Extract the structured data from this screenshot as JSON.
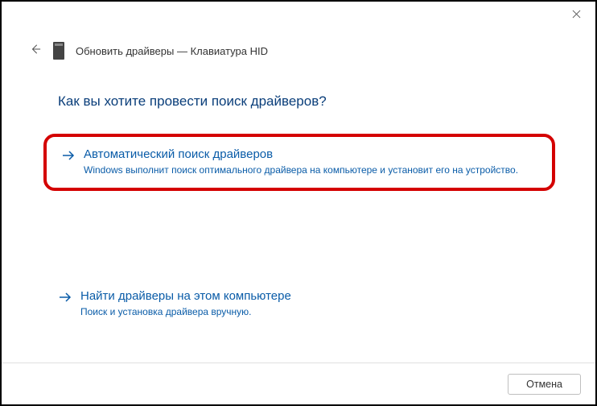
{
  "window": {
    "title": "Обновить драйверы — Клавиатура HID"
  },
  "question": "Как вы хотите провести поиск драйверов?",
  "options": {
    "auto": {
      "title": "Автоматический поиск драйверов",
      "desc": "Windows выполнит поиск оптимального драйвера на компьютере и установит его на устройство."
    },
    "manual": {
      "title": "Найти драйверы на этом компьютере",
      "desc": "Поиск и установка драйвера вручную."
    }
  },
  "buttons": {
    "cancel": "Отмена"
  }
}
